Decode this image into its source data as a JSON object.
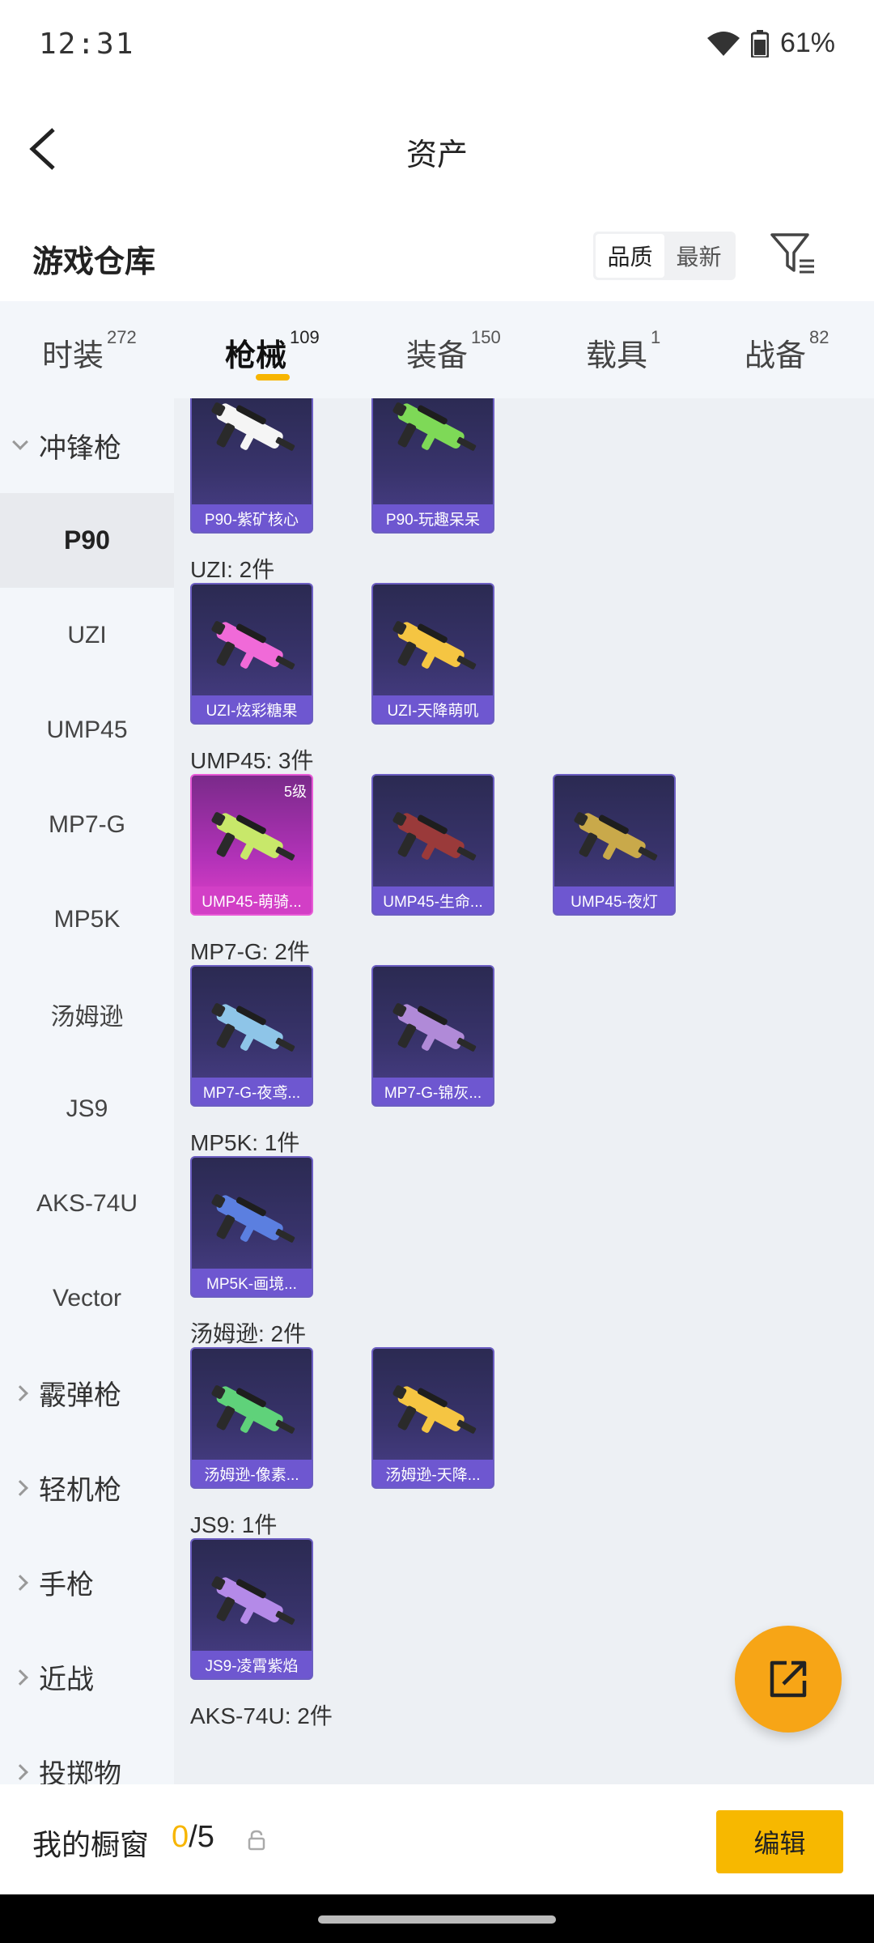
{
  "status": {
    "time": "12:31",
    "battery": "61%"
  },
  "header": {
    "title": "资产"
  },
  "warehouse": {
    "title": "游戏仓库",
    "sort_options": [
      "品质",
      "最新"
    ],
    "sort_active": "品质"
  },
  "tabs": [
    {
      "label": "时装",
      "count": "272"
    },
    {
      "label": "枪械",
      "count": "109"
    },
    {
      "label": "装备",
      "count": "150"
    },
    {
      "label": "载具",
      "count": "1"
    },
    {
      "label": "战备",
      "count": "82"
    }
  ],
  "active_tab": "枪械",
  "sidebar": {
    "category_open": "冲锋枪",
    "items": [
      "P90",
      "UZI",
      "UMP45",
      "MP7-G",
      "MP5K",
      "汤姆逊",
      "JS9",
      "AKS-74U",
      "Vector"
    ],
    "active_item": "P90",
    "collapsed_categories": [
      "霰弹枪",
      "轻机枪",
      "手枪",
      "近战",
      "投掷物"
    ]
  },
  "sections": [
    {
      "label": "",
      "items": [
        {
          "name": "P90-紫矿核心",
          "accent": "#f5f5f5"
        },
        {
          "name": "P90-玩趣呆呆",
          "accent": "#7ed957"
        }
      ]
    },
    {
      "label": "UZI: 2件",
      "items": [
        {
          "name": "UZI-炫彩糖果",
          "accent": "#f06ad8"
        },
        {
          "name": "UZI-天降萌叽",
          "accent": "#f5c542"
        }
      ]
    },
    {
      "label": "UMP45: 3件",
      "items": [
        {
          "name": "UMP45-萌骑...",
          "accent": "#c8e86a",
          "badge": "5级",
          "rarity": "pink"
        },
        {
          "name": "UMP45-生命...",
          "accent": "#9a3a3a"
        },
        {
          "name": "UMP45-夜灯",
          "accent": "#c9a94a"
        }
      ]
    },
    {
      "label": "MP7-G: 2件",
      "items": [
        {
          "name": "MP7-G-夜鸢...",
          "accent": "#8ec5e8"
        },
        {
          "name": "MP7-G-锦灰...",
          "accent": "#b08ad8"
        }
      ]
    },
    {
      "label": "MP5K: 1件",
      "items": [
        {
          "name": "MP5K-画境...",
          "accent": "#5b7fe0"
        }
      ]
    },
    {
      "label": "汤姆逊: 2件",
      "items": [
        {
          "name": "汤姆逊-像素...",
          "accent": "#5fd27a"
        },
        {
          "name": "汤姆逊-天降...",
          "accent": "#f5c542"
        }
      ]
    },
    {
      "label": "JS9: 1件",
      "items": [
        {
          "name": "JS9-凌霄紫焰",
          "accent": "#b48ae8"
        }
      ]
    },
    {
      "label": "AKS-74U: 2件",
      "items": []
    }
  ],
  "bottom": {
    "label": "我的橱窗",
    "current": "0",
    "total": "/5",
    "edit_label": "编辑"
  },
  "colors": {
    "accent": "#f7b500",
    "card": "#38336b",
    "caption": "#6e57d0"
  }
}
